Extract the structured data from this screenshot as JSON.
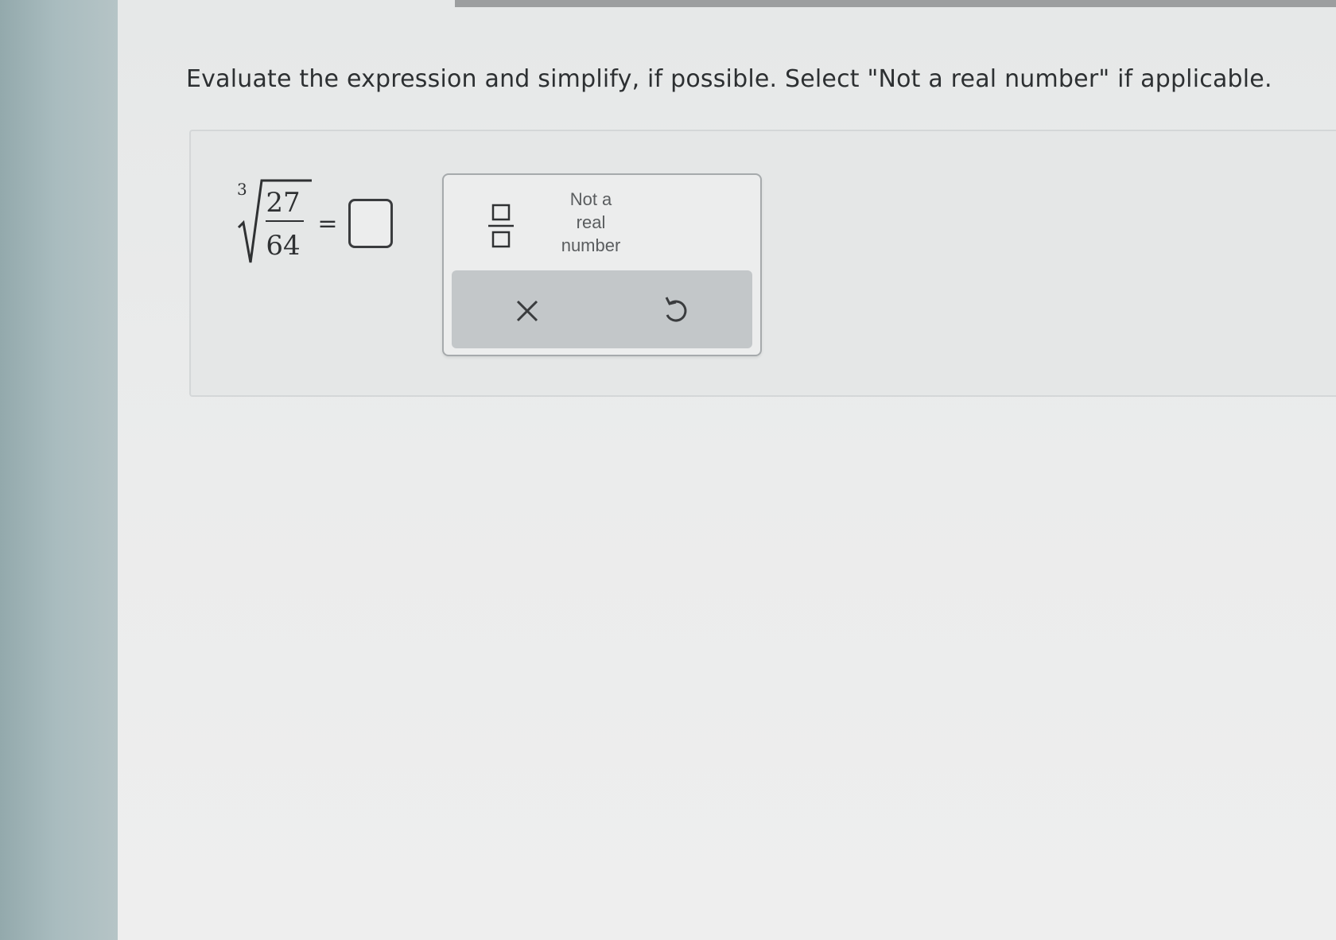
{
  "question": {
    "text": "Evaluate the expression and simplify, if possible. Select \"Not a real number\" if applicable."
  },
  "expression": {
    "index": "3",
    "numerator": "27",
    "denominator": "64",
    "equals": "="
  },
  "answer": {
    "value": ""
  },
  "keypad": {
    "not_real_line1": "Not a",
    "not_real_line2": "real",
    "not_real_line3": "number",
    "clear_icon": "close-icon",
    "undo_icon": "undo-icon"
  }
}
